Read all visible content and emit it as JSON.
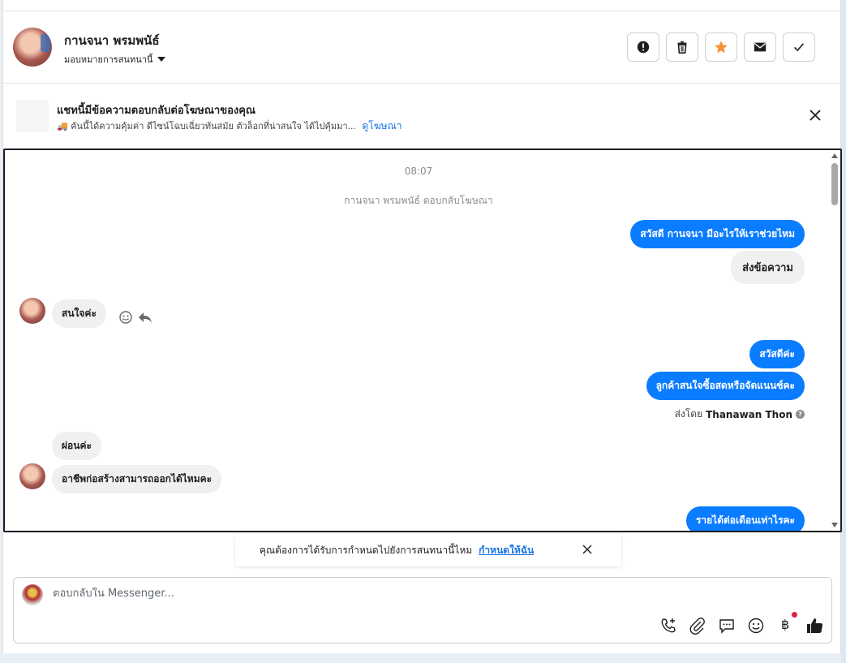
{
  "header": {
    "contact_name": "กานจนา พรมพนัธ์",
    "assign_label": "มอบหมายการสนทนานี้",
    "actions": [
      "spam",
      "delete",
      "star",
      "mark-unread",
      "done"
    ]
  },
  "ad_banner": {
    "title": "แชทนี้มีข้อความตอบกลับต่อโฆษณาของคุณ",
    "description": "🚚 คันนี้ได้ความคุ้มค่า ดีไซน์โฉบเฉี่ยวทันสมัย ตัวล็อกที่น่าสนใจ ได้ไปคุ้มมา...",
    "link_label": "ดูโฆษณา"
  },
  "chat": {
    "timestamp": "08:07",
    "notice": "กานจนา พรมพนัธ์ ตอบกลับโฆษณา",
    "messages": [
      {
        "dir": "out",
        "text": "สวัสดี กานจนา มีอะไรให้เราช่วยไหม"
      },
      {
        "dir": "in-gray-right",
        "text": "ส่งข้อความ"
      },
      {
        "dir": "in",
        "text": "สนใจค่ะ"
      },
      {
        "dir": "out",
        "text": "สวัสดีค่ะ"
      },
      {
        "dir": "out",
        "text": "ลูกค้าสนใจซื้อสดหรือจัดแนนซ์คะ"
      },
      {
        "dir": "in",
        "text": "ผ่อนค่ะ"
      },
      {
        "dir": "in",
        "text": "อาชีพก่อสร้างสามารถออกได้ไหมคะ"
      },
      {
        "dir": "out",
        "text": "รายได้ต่อเดือนเท่าไรคะ"
      }
    ],
    "sent_by_label": "ส่งโดย",
    "sent_by_name": "Thanawan Thon"
  },
  "toast": {
    "text": "คุณต้องการได้รับการกำหนดไปยังการสนทนานี้ไหม",
    "link_label": "กำหนดให้ฉัน"
  },
  "composer": {
    "placeholder": "ตอบกลับใน Messenger...",
    "tools": [
      "call-icon",
      "attachment-icon",
      "saved-replies-icon",
      "emoji-icon",
      "baht-icon",
      "thumbs-up-icon"
    ]
  },
  "colors": {
    "outgoing_bubble": "#0a7cff",
    "incoming_bubble": "#f0f0f0",
    "link": "#1b74e4",
    "star": "#f7923b"
  }
}
